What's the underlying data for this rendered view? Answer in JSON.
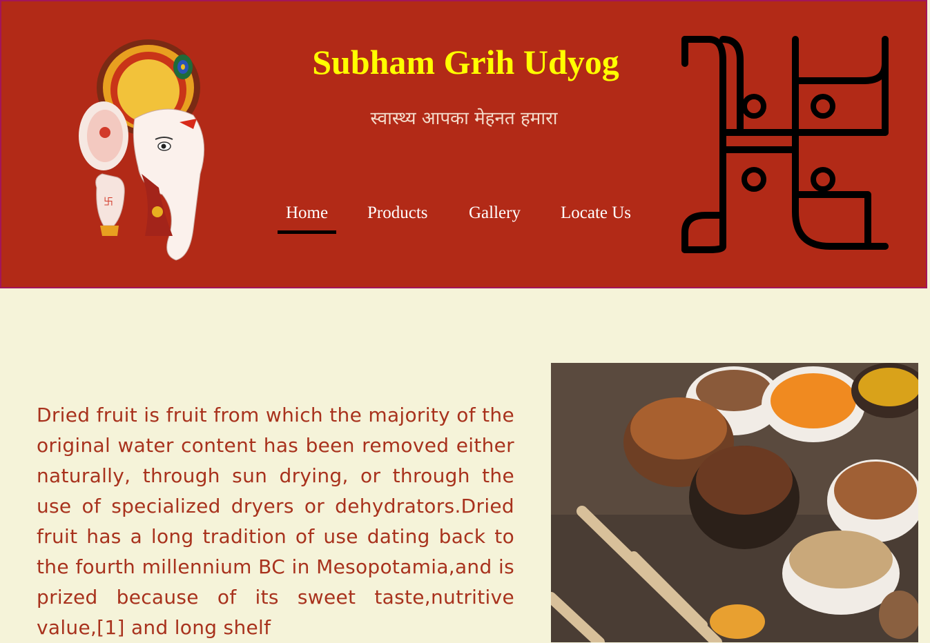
{
  "header": {
    "title": "Subham Grih Udyog",
    "tagline": "स्वास्थ्य आपका मेहनत हमारा",
    "background_color": "#b22a17",
    "title_color": "#ffff00"
  },
  "nav": {
    "items": [
      {
        "label": "Home",
        "active": true
      },
      {
        "label": "Products",
        "active": false
      },
      {
        "label": "Gallery",
        "active": false
      },
      {
        "label": "Locate Us",
        "active": false
      }
    ]
  },
  "logos": {
    "left": "ganesha-image",
    "right": "swastika-icon"
  },
  "main": {
    "paragraph": "Dried fruit is fruit from which the majority of the original water content has been removed either naturally, through sun drying, or through the use of specialized dryers or dehydrators.Dried fruit has a long tradition of use dating back to the fourth millennium BC in Mesopotamia,and is prized because of its sweet taste,nutritive value,[1] and long shelf",
    "text_color": "#a8321d",
    "image": "dried-fruits-photo"
  }
}
